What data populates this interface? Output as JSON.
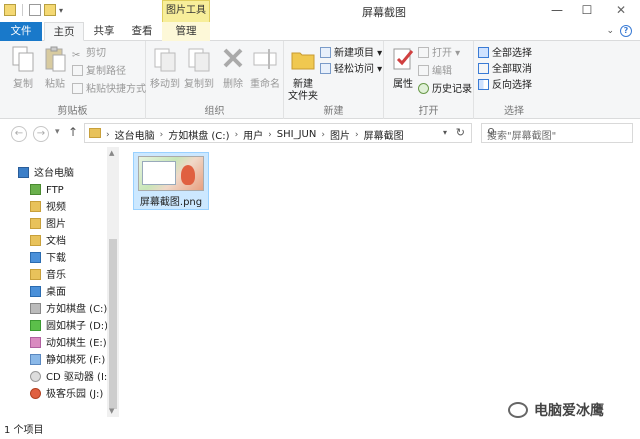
{
  "window": {
    "title": "屏幕截图",
    "context_tab": "图片工具",
    "min": "—",
    "max": "☐",
    "close": "✕"
  },
  "tabs": [
    {
      "label": "文件"
    },
    {
      "label": "主页"
    },
    {
      "label": "共享"
    },
    {
      "label": "查看"
    },
    {
      "label": "管理"
    }
  ],
  "help_icon": "help-icon",
  "ribbon": {
    "clipboard": {
      "label": "剪贴板",
      "copy": "复制",
      "paste": "粘贴",
      "cut": "剪切",
      "copy_path": "复制路径",
      "paste_shortcut": "粘贴快捷方式"
    },
    "organize": {
      "label": "组织",
      "move_to": "移动到",
      "copy_to": "复制到",
      "delete": "删除",
      "rename": "重命名"
    },
    "new": {
      "label": "新建",
      "new_folder_line1": "新建",
      "new_folder_line2": "文件夹",
      "new_item": "新建项目",
      "easy_access": "轻松访问"
    },
    "open": {
      "label": "打开",
      "properties": "属性",
      "open": "打开",
      "edit": "编辑",
      "history": "历史记录"
    },
    "select": {
      "label": "选择",
      "select_all": "全部选择",
      "select_none": "全部取消",
      "invert": "反向选择"
    }
  },
  "address": {
    "back": "←",
    "forward": "→",
    "up": "↑",
    "crumbs": [
      "这台电脑",
      "方如棋盘 (C:)",
      "用户",
      "SHI_JUN",
      "图片",
      "屏幕截图"
    ],
    "search_placeholder": "搜索\"屏幕截图\""
  },
  "nav": {
    "items": [
      {
        "label": "这台电脑"
      },
      {
        "label": "FTP"
      },
      {
        "label": "视频"
      },
      {
        "label": "图片"
      },
      {
        "label": "文档"
      },
      {
        "label": "下载"
      },
      {
        "label": "音乐"
      },
      {
        "label": "桌面"
      },
      {
        "label": "方如棋盘 (C:)"
      },
      {
        "label": "圆如棋子 (D:)"
      },
      {
        "label": "动如棋生 (E:)"
      },
      {
        "label": "静如棋死 (F:)"
      },
      {
        "label": "CD 驱动器 (I:) 我"
      },
      {
        "label": "极客乐园 (J:)"
      }
    ]
  },
  "files": [
    {
      "name": "屏幕截图.png"
    }
  ],
  "status": "1 个项目",
  "watermark": "电脑爱冰鹰",
  "colors": {
    "file_tab": "#1979ca",
    "context_tab": "#f7ee9a",
    "selection": "#cce8ff",
    "selection_border": "#99d1ff"
  }
}
